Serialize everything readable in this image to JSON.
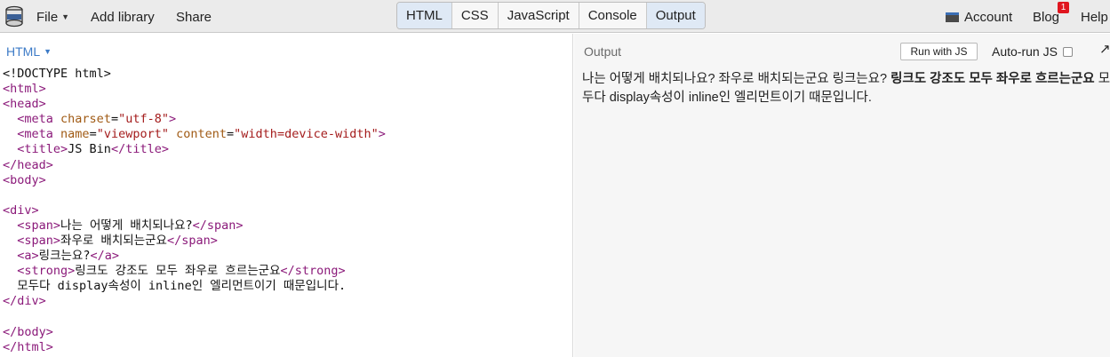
{
  "app": {
    "logo_icon": "jsbin-logo-icon"
  },
  "menu": {
    "file": "File",
    "add_library": "Add library",
    "share": "Share"
  },
  "panel_tabs": [
    "HTML",
    "CSS",
    "JavaScript",
    "Console",
    "Output"
  ],
  "active_tabs": [
    "HTML",
    "Output"
  ],
  "right_menu": {
    "account": "Account",
    "blog": "Blog",
    "blog_badge": "1",
    "help": "Help"
  },
  "html_panel": {
    "label": "HTML",
    "code_lines": [
      [
        [
          "text",
          "<!DOCTYPE html>"
        ]
      ],
      [
        [
          "tag",
          "<html>"
        ]
      ],
      [
        [
          "tag",
          "<head>"
        ]
      ],
      [
        [
          "text",
          "  "
        ],
        [
          "tag",
          "<meta"
        ],
        [
          "text",
          " "
        ],
        [
          "attr",
          "charset"
        ],
        [
          "text",
          "="
        ],
        [
          "str",
          "\"utf-8\""
        ],
        [
          "tag",
          ">"
        ]
      ],
      [
        [
          "text",
          "  "
        ],
        [
          "tag",
          "<meta"
        ],
        [
          "text",
          " "
        ],
        [
          "attr",
          "name"
        ],
        [
          "text",
          "="
        ],
        [
          "str",
          "\"viewport\""
        ],
        [
          "text",
          " "
        ],
        [
          "attr",
          "content"
        ],
        [
          "text",
          "="
        ],
        [
          "str",
          "\"width=device-width\""
        ],
        [
          "tag",
          ">"
        ]
      ],
      [
        [
          "text",
          "  "
        ],
        [
          "tag",
          "<title>"
        ],
        [
          "text",
          "JS Bin"
        ],
        [
          "tag",
          "</title>"
        ]
      ],
      [
        [
          "tag",
          "</head>"
        ]
      ],
      [
        [
          "tag",
          "<body>"
        ]
      ],
      [
        [
          "text",
          ""
        ]
      ],
      [
        [
          "tag",
          "<div>"
        ]
      ],
      [
        [
          "text",
          "  "
        ],
        [
          "tag",
          "<span>"
        ],
        [
          "text",
          "나는 어떻게 배치되나요?"
        ],
        [
          "tag",
          "</span>"
        ]
      ],
      [
        [
          "text",
          "  "
        ],
        [
          "tag",
          "<span>"
        ],
        [
          "text",
          "좌우로 배치되는군요"
        ],
        [
          "tag",
          "</span>"
        ]
      ],
      [
        [
          "text",
          "  "
        ],
        [
          "tag",
          "<a>"
        ],
        [
          "text",
          "링크는요?"
        ],
        [
          "tag",
          "</a>"
        ]
      ],
      [
        [
          "text",
          "  "
        ],
        [
          "tag",
          "<strong>"
        ],
        [
          "text",
          "링크도 강조도 모두 좌우로 흐르는군요"
        ],
        [
          "tag",
          "</strong>"
        ]
      ],
      [
        [
          "text",
          "  모두다 display속성이 inline인 엘리먼트이기 때문입니다."
        ]
      ],
      [
        [
          "tag",
          "</div>"
        ]
      ],
      [
        [
          "text",
          ""
        ]
      ],
      [
        [
          "tag",
          "</body>"
        ]
      ],
      [
        [
          "tag",
          "</html>"
        ]
      ]
    ]
  },
  "output_panel": {
    "label": "Output",
    "run_button": "Run with JS",
    "auto_run": "Auto-run JS",
    "auto_run_checked": false,
    "expand_icon": "expand-arrow-icon",
    "content": {
      "span1": "나는 어떻게 배치되나요?",
      "span2": "좌우로 배치되는군요",
      "link": "링크는요?",
      "strong": "링크도 강조도 모두 좌우로 흐르는군요",
      "trailing": "모두다 display속성이 inline인 엘리먼트이기 때문입니다."
    }
  },
  "colors": {
    "tag": "#8b1a7a",
    "attr": "#a05a14",
    "string": "#a41c1c",
    "accent": "#3d7bc7",
    "active_tab": "#dfe9f5",
    "badge": "#e0161f"
  }
}
